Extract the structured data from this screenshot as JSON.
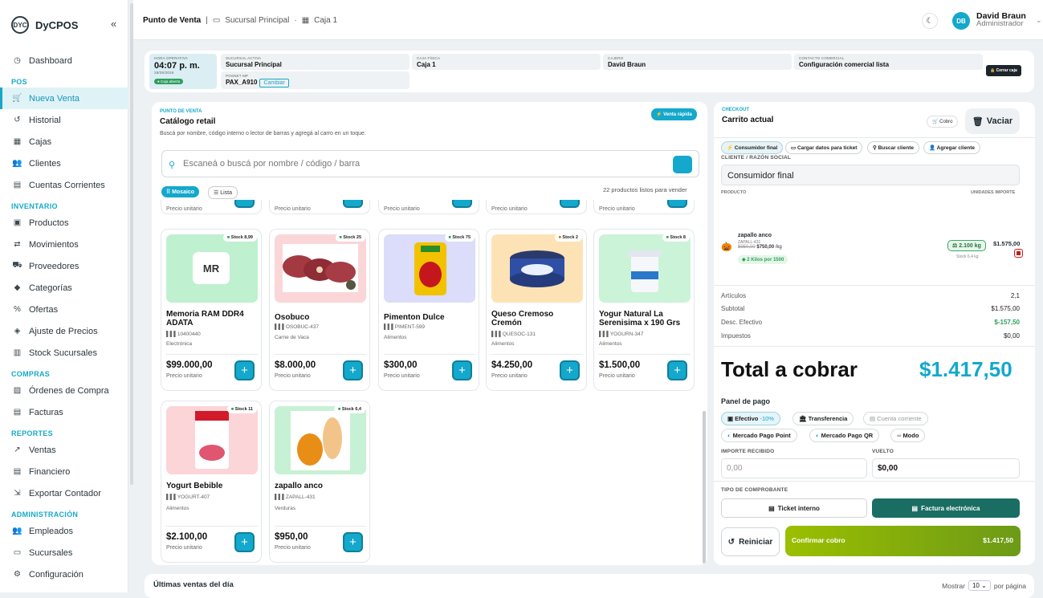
{
  "brand": {
    "logo": "DYC",
    "name": "DyCPOS",
    "collapse": "«"
  },
  "nav": {
    "items": [
      {
        "label": "Dashboard",
        "icon": "◷"
      }
    ],
    "sections": [
      {
        "title": "POS",
        "items": [
          {
            "label": "Nueva Venta",
            "icon": "🛒",
            "active": true
          },
          {
            "label": "Historial",
            "icon": "↺"
          },
          {
            "label": "Cajas",
            "icon": "▦"
          },
          {
            "label": "Clientes",
            "icon": "👥"
          },
          {
            "label": "Cuentas Corrientes",
            "icon": "▤"
          }
        ]
      },
      {
        "title": "INVENTARIO",
        "items": [
          {
            "label": "Productos",
            "icon": "▣"
          },
          {
            "label": "Movimientos",
            "icon": "⇄"
          },
          {
            "label": "Proveedores",
            "icon": "⛟"
          },
          {
            "label": "Categorías",
            "icon": "◆"
          },
          {
            "label": "Ofertas",
            "icon": "%"
          },
          {
            "label": "Ajuste de Precios",
            "icon": "◈"
          },
          {
            "label": "Stock Sucursales",
            "icon": "▥"
          }
        ]
      },
      {
        "title": "COMPRAS",
        "items": [
          {
            "label": "Órdenes de Compra",
            "icon": "▨"
          },
          {
            "label": "Facturas",
            "icon": "▤"
          }
        ]
      },
      {
        "title": "REPORTES",
        "items": [
          {
            "label": "Ventas",
            "icon": "↗"
          },
          {
            "label": "Financiero",
            "icon": "▤"
          },
          {
            "label": "Exportar Contador",
            "icon": "⇲"
          }
        ]
      },
      {
        "title": "ADMINISTRACIÓN",
        "items": [
          {
            "label": "Empleados",
            "icon": "👥"
          },
          {
            "label": "Sucursales",
            "icon": "▭"
          },
          {
            "label": "Configuración",
            "icon": "⚙"
          }
        ]
      }
    ]
  },
  "topbar": {
    "page": "Punto de Venta",
    "sep": "|",
    "branch": "Sucursal Principal",
    "dot": "·",
    "register": "Caja 1",
    "user_initials": "DB",
    "user_name": "David Braun",
    "user_role": "Administrador"
  },
  "info": {
    "hora_k": "HORA OPERATIVA",
    "hora_v": "04:07 p. m.",
    "fecha": "28/05/2026",
    "estado": "Caja abierta",
    "suc_k": "SUCURSAL ACTIVA",
    "suc_v": "Sucursal Principal",
    "point_k": "POSNET MP",
    "point_v": "PAX_A910",
    "cambiar": "Cambiar",
    "caja_k": "CAJA FÍSICA",
    "caja_v": "Caja 1",
    "cajero_k": "CAJERO",
    "cajero_v": "David Braun",
    "contacto_k": "CONTACTO COMERCIAL",
    "contacto_v": "Configuración comercial lista",
    "cerrar": "Cerrar caja"
  },
  "catalog": {
    "kicker": "PUNTO DE VENTA",
    "title": "Catálogo retail",
    "subtitle": "Buscá por nombre, código interno o lector de barras y agregá al carro en un toque.",
    "quick": "⚡ Venta rápida",
    "search_placeholder": "Escaneá o buscá por nombre / código / barra",
    "view_grid": "⠿ Mosaico",
    "view_list": "☰ Lista",
    "count": "22 productos listos para vender",
    "unit_label": "Precio unitario",
    "products": [
      {
        "name": "Memoria RAM DDR4 ADATA",
        "code": "10400440",
        "category": "Electrónica",
        "stock": "Stock 8,99",
        "price": "$99.000,00",
        "placeholder": "MR",
        "bg": "#bff0cf"
      },
      {
        "name": "Osobuco",
        "code": "OSOBUC-437",
        "category": "Carne de Vaca",
        "stock": "Stock 25",
        "price": "$8.000,00",
        "bg": "#fbd6d8"
      },
      {
        "name": "Pimenton Dulce",
        "code": "PIMENT-599",
        "category": "Alimentos",
        "stock": "Stock 75",
        "price": "$300,00",
        "bg": "#dcdcfb"
      },
      {
        "name": "Queso Cremoso Cremón",
        "code": "QUESOC-131",
        "category": "Alimentos",
        "stock": "Stock 2",
        "price": "$4.250,00",
        "bg": "#fde2b6"
      },
      {
        "name": "Yogur Natural La Serenisima x 190 Grs",
        "code": "YOGURN-347",
        "category": "Alimentos",
        "stock": "Stock 8",
        "price": "$1.500,00",
        "bg": "#cbf3d8"
      },
      {
        "name": "Yogurt Bebible",
        "code": "YOGURT-407",
        "category": "Alimentos",
        "stock": "Stock 11",
        "price": "$2.100,00",
        "bg": "#fcd5d8"
      },
      {
        "name": "zapallo anco",
        "code": "ZAPALL-431",
        "category": "Verduras",
        "stock": "Stock 6,4",
        "price": "$950,00",
        "bg": "#c7f1d4"
      }
    ]
  },
  "checkout": {
    "kicker": "CHECKOUT",
    "title": "Carrito actual",
    "cobro": "Cobro",
    "vaciar": "Vaciar",
    "chips": [
      "Consumidor final",
      "Cargar datos para ticket",
      "Buscar cliente",
      "Agregar cliente"
    ],
    "cliente_label": "CLIENTE / RAZÓN SOCIAL",
    "cliente_value": "Consumidor final",
    "col_producto": "PRODUCTO",
    "col_right": "UNIDADES  IMPORTE",
    "item": {
      "name": "zapallo anco",
      "code": "ZAPALL-431",
      "old_price": "$950,00",
      "new_price": "$750,00",
      "unit": "/kg",
      "promo": "2 Kilos por 1500",
      "qty": "2.100 kg",
      "stock": "Stock 6.4 kg",
      "total": "$1.575,00"
    },
    "summary": [
      {
        "label": "Artículos",
        "value": "2,1"
      },
      {
        "label": "Subtotal",
        "value": "$1.575,00"
      },
      {
        "label": "Desc. Efectivo",
        "value": "$-157,50"
      },
      {
        "label": "Impuestos",
        "value": "$0,00"
      }
    ],
    "total_label": "Total a cobrar",
    "total_value": "$1.417,50",
    "panel_title": "Panel de pago",
    "methods": [
      {
        "label": "Efectivo",
        "extra": "-10%"
      },
      {
        "label": "Transferencia"
      },
      {
        "label": "Cuenta corriente"
      },
      {
        "label": "Mercado Pago Point"
      },
      {
        "label": "Mercado Pago QR"
      },
      {
        "label": "Modo"
      }
    ],
    "importe_label": "IMPORTE RECIBIDO",
    "importe_placeholder": "0,00",
    "vuelto_label": "VUELTO",
    "vuelto_value": "$0,00",
    "comprobante_label": "TIPO DE COMPROBANTE",
    "ticket": "Ticket interno",
    "factura": "Factura electrónica",
    "reiniciar": "Reiniciar",
    "confirmar": "Confirmar cobro",
    "confirmar_total": "$1.417,50"
  },
  "bottom": {
    "title": "Últimas ventas del día",
    "mostrar": "Mostrar",
    "per_page": "10",
    "por_pagina": "por página"
  }
}
